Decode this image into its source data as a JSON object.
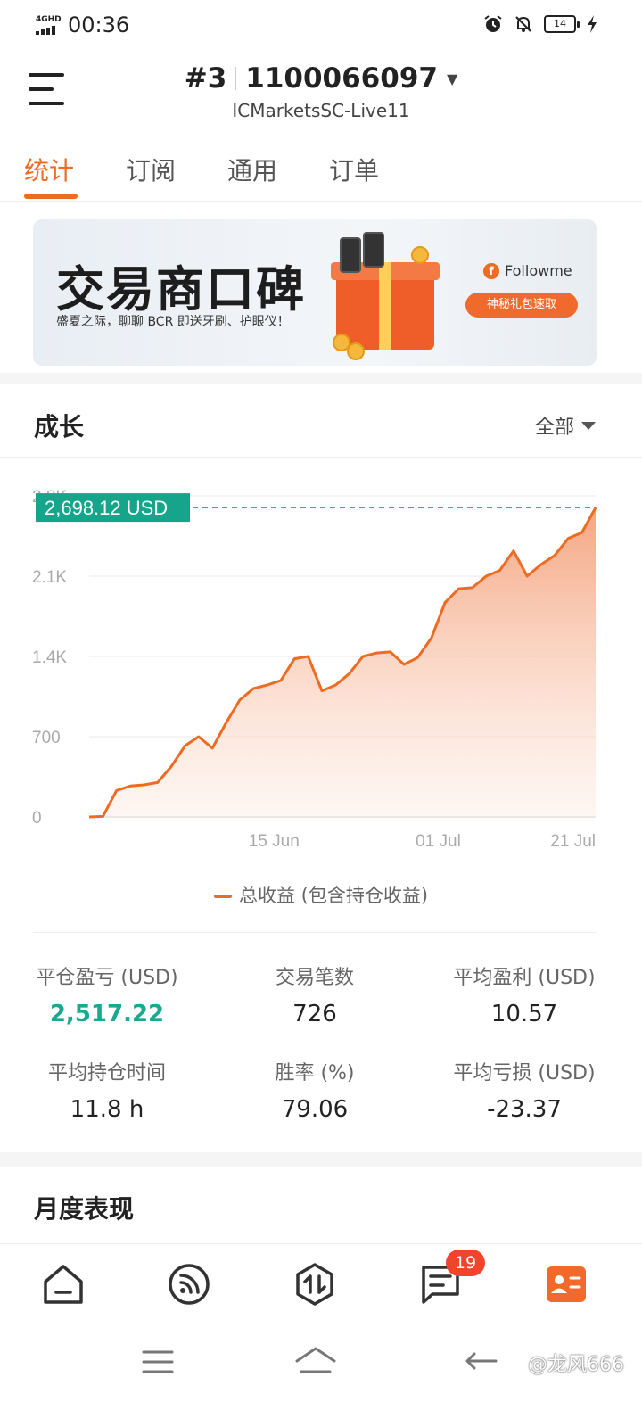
{
  "status_bar": {
    "network": "4GHD",
    "time": "00:36",
    "battery": "14"
  },
  "header": {
    "account_index": "#3",
    "account_number": "1100066097",
    "server": "ICMarketsSC-Live11"
  },
  "tabs": [
    {
      "label": "统计",
      "active": true
    },
    {
      "label": "订阅",
      "active": false
    },
    {
      "label": "通用",
      "active": false
    },
    {
      "label": "订单",
      "active": false
    }
  ],
  "banner": {
    "title": "交易商口碑",
    "subtitle": "盛夏之际，聊聊 BCR 即送牙刷、护眼仪！",
    "brand": "Followme",
    "brand_letter": "f",
    "button_label": "神秘礼包速取"
  },
  "growth": {
    "title": "成长",
    "range_label": "全部"
  },
  "chart_data": {
    "type": "area",
    "series": [
      {
        "name": "总收益 (包含持仓收益)",
        "color": "#ee6b22",
        "values": [
          0,
          5,
          230,
          270,
          280,
          300,
          440,
          620,
          700,
          600,
          820,
          1020,
          1120,
          1150,
          1190,
          1380,
          1400,
          1100,
          1150,
          1250,
          1400,
          1430,
          1440,
          1330,
          1390,
          1560,
          1870,
          1990,
          2000,
          2100,
          2150,
          2320,
          2100,
          2200,
          2280,
          2430,
          2480,
          2698.12
        ]
      }
    ],
    "x_ticks": [
      "15 Jun",
      "01 Jul",
      "21 Jul"
    ],
    "x_tick_index": [
      13.5,
      25.5,
      37
    ],
    "y_ticks": [
      0,
      700,
      1400,
      2100,
      2800
    ],
    "y_tick_labels": [
      "0",
      "700",
      "1.4K",
      "2.1K",
      "2.8K"
    ],
    "ylim": [
      0,
      2800
    ],
    "current_value_label": "2,698.12 USD",
    "line_color": "#ee6b22",
    "marker_color": "#14a58a"
  },
  "legend": {
    "label": "总收益 (包含持仓收益)"
  },
  "stats": {
    "closed_pnl": {
      "label": "平仓盈亏 (USD)",
      "value": "2,517.22"
    },
    "trades": {
      "label": "交易笔数",
      "value": "726"
    },
    "avg_profit": {
      "label": "平均盈利 (USD)",
      "value": "10.57"
    },
    "avg_hold": {
      "label": "平均持仓时间",
      "value": "11.8 h"
    },
    "win_rate": {
      "label": "胜率 (%)",
      "value": "79.06"
    },
    "avg_loss": {
      "label": "平均亏损 (USD)",
      "value": "-23.37"
    }
  },
  "monthly": {
    "title": "月度表现"
  },
  "nav": {
    "messages_badge": "19"
  },
  "watermark": "@龙风666",
  "colors": {
    "accent": "#ee6b22",
    "positive": "#1aa88f"
  }
}
